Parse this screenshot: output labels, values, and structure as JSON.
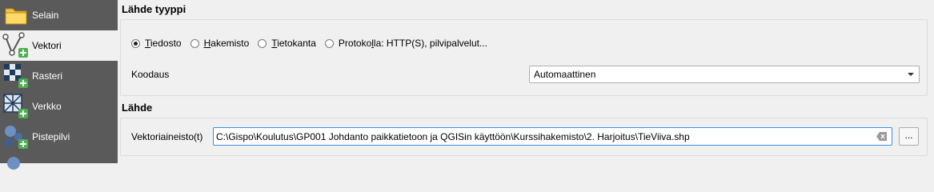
{
  "sidebar": {
    "items": [
      {
        "label": "Selain",
        "icon": "folder-icon",
        "active": false
      },
      {
        "label": "Vektori",
        "icon": "vector-add-icon",
        "active": true
      },
      {
        "label": "Rasteri",
        "icon": "raster-add-icon",
        "active": false
      },
      {
        "label": "Verkko",
        "icon": "mesh-add-icon",
        "active": false
      },
      {
        "label": "Pistepilvi",
        "icon": "pointcloud-add-icon",
        "active": false
      }
    ]
  },
  "source_type": {
    "title": "Lähde tyyppi",
    "options": [
      {
        "accel": "T",
        "rest": "iedosto",
        "checked": true
      },
      {
        "accel": "H",
        "rest": "akemisto",
        "checked": false
      },
      {
        "accel": "T",
        "rest": "ietokanta",
        "checked": false
      },
      {
        "pre": "Protoko",
        "accel": "l",
        "rest": "la: HTTP(S), pilvipalvelut...",
        "checked": false
      }
    ],
    "encoding_label": "Koodaus",
    "encoding_value": "Automaattinen"
  },
  "source": {
    "title": "Lähde",
    "dataset_label": "Vektoriaineisto(t)",
    "dataset_value": "C:\\Gispo\\Koulutus\\GP001 Johdanto paikkatietoon ja QGISin käyttöön\\Kurssihakemisto\\2. Harjoitus\\TieViiva.shp",
    "browse_label": "..."
  },
  "colors": {
    "sidebar_bg": "#5a5a5a",
    "accent_green": "#4caf50",
    "input_focus": "#3a8ee6"
  }
}
